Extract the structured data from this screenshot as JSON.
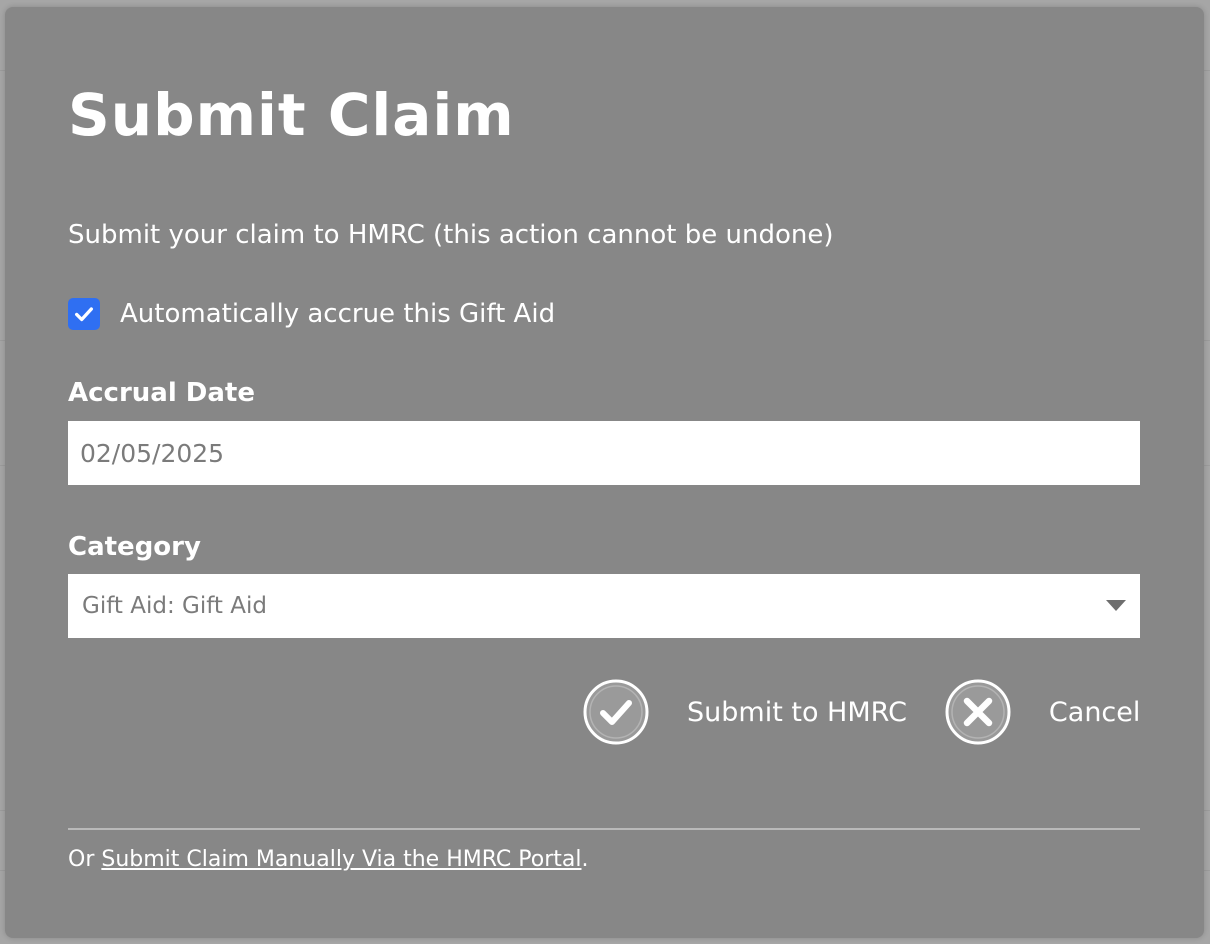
{
  "modal": {
    "title": "Submit Claim",
    "description": "Submit your claim to HMRC (this action cannot be undone)"
  },
  "auto_accrue": {
    "label": "Automatically accrue this Gift Aid",
    "checked": true
  },
  "accrual_date": {
    "label": "Accrual Date",
    "value": "02/05/2025"
  },
  "category": {
    "label": "Category",
    "selected": "Gift Aid: Gift Aid"
  },
  "actions": {
    "submit_label": "Submit to HMRC",
    "cancel_label": "Cancel"
  },
  "footer": {
    "prefix": "Or ",
    "link_text": "Submit Claim Manually Via the HMRC Portal",
    "suffix": "."
  },
  "colors": {
    "overlay": "#878787",
    "checkbox": "#2f6ff2",
    "text": "#ffffff",
    "input_text": "#7b7b7b"
  },
  "icons": {
    "checkbox": "check-icon",
    "submit": "check-circle-icon",
    "cancel": "x-circle-icon",
    "dropdown": "caret-down-icon"
  }
}
